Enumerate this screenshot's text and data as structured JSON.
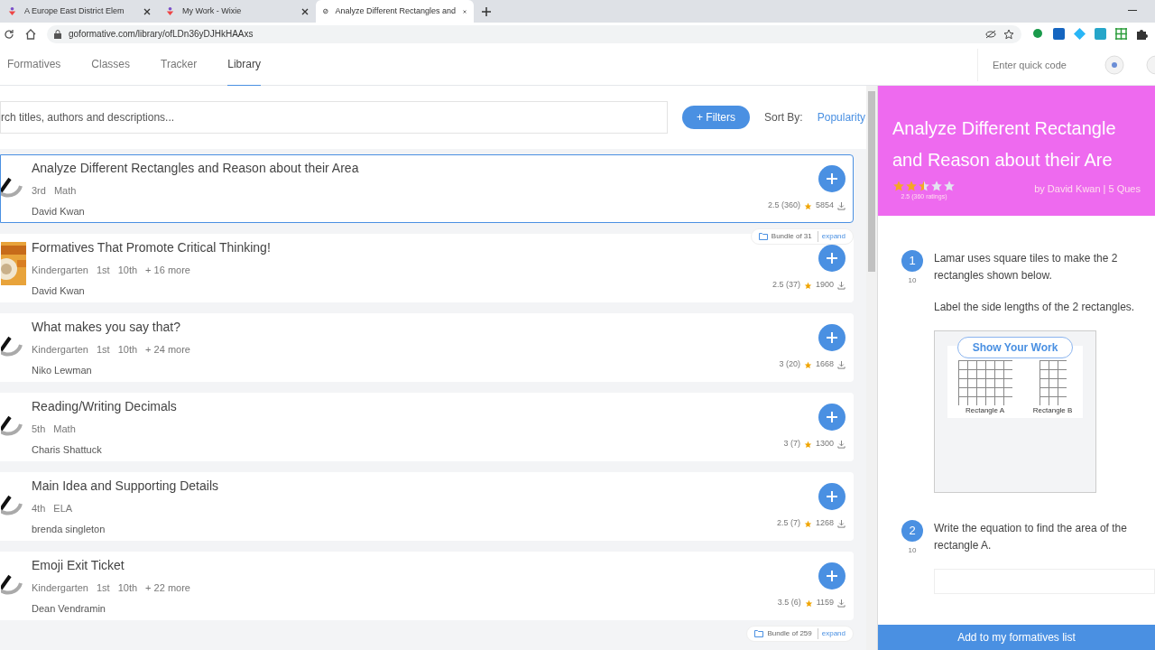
{
  "browser": {
    "tabs": [
      {
        "title": "A Europe East District Elem",
        "selected": false
      },
      {
        "title": "My Work - Wixie",
        "selected": false
      },
      {
        "title": "Analyze Different Rectangles and",
        "selected": true
      }
    ],
    "url": "goformative.com/library/ofLDn36yDJHkHAAxs"
  },
  "nav": {
    "items": [
      {
        "label": "Formatives",
        "selected": false
      },
      {
        "label": "Classes",
        "selected": false
      },
      {
        "label": "Tracker",
        "selected": false
      },
      {
        "label": "Library",
        "selected": true
      }
    ],
    "quick_code_placeholder": "Enter quick code"
  },
  "search": {
    "placeholder": "rch titles, authors and descriptions...",
    "filters": "+ Filters",
    "sort_label": "Sort By:",
    "sort_value": "Popularity"
  },
  "results": [
    {
      "title": "Analyze Different Rectangles and Reason about their Area",
      "tags": [
        "3rd",
        "Math"
      ],
      "author": "David Kwan",
      "rating": "2.5 (360)",
      "downloads": "5854",
      "kind": "logo",
      "selected": true,
      "bundle": {
        "label": "Bundle of 31",
        "action": "expand"
      }
    },
    {
      "title": "Formatives That Promote Critical Thinking!",
      "tags": [
        "Kindergarten",
        "1st",
        "10th",
        "+ 16 more"
      ],
      "author": "David Kwan",
      "rating": "2.5 (37)",
      "downloads": "1900",
      "kind": "picture",
      "selected": false
    },
    {
      "title": "What makes you say that?",
      "tags": [
        "Kindergarten",
        "1st",
        "10th",
        "+ 24 more"
      ],
      "author": "Niko Lewman",
      "rating": "3 (20)",
      "downloads": "1668",
      "kind": "logo",
      "selected": false
    },
    {
      "title": "Reading/Writing Decimals",
      "tags": [
        "5th",
        "Math"
      ],
      "author": "Charis Shattuck",
      "rating": "3 (7)",
      "downloads": "1300",
      "kind": "logo",
      "selected": false
    },
    {
      "title": "Main Idea and Supporting Details",
      "tags": [
        "4th",
        "ELA"
      ],
      "author": "brenda singleton",
      "rating": "2.5 (7)",
      "downloads": "1268",
      "kind": "logo",
      "selected": false
    },
    {
      "title": "Emoji Exit Ticket",
      "tags": [
        "Kindergarten",
        "1st",
        "10th",
        "+ 22 more"
      ],
      "author": "Dean Vendramin",
      "rating": "3.5 (6)",
      "downloads": "1159",
      "kind": "logo",
      "selected": false,
      "bundle": {
        "label": "Bundle of 259",
        "action": "expand"
      }
    }
  ],
  "preview": {
    "title_lines": [
      "Analyze Different Rectangle",
      "and Reason about their Are"
    ],
    "stars": 2.5,
    "ratings": "2.5 (360 ratings)",
    "byline": "by David Kwan | 5 Ques",
    "questions": [
      {
        "number": "1",
        "points": "10",
        "paragraphs": [
          "Lamar uses square tiles to make the 2 rectangles shown below.",
          "Label the side lengths of the 2 rectangles."
        ],
        "kind": "drawing",
        "button": "Show Your Work",
        "figure_labels": [
          "Rectangle A",
          "Rectangle B"
        ]
      },
      {
        "number": "2",
        "points": "10",
        "paragraphs": [
          "Write the equation to find the area of the rectangle A."
        ],
        "kind": "text"
      }
    ],
    "add_button": "Add to my formatives list"
  }
}
